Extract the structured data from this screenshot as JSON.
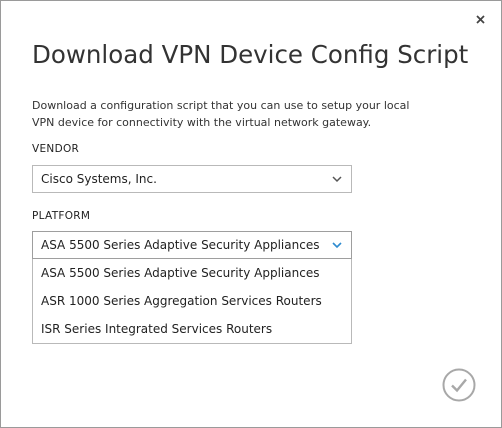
{
  "dialog": {
    "title": "Download VPN Device Config Script",
    "description": "Download a configuration script that you can use to setup your local VPN device for connectivity with the virtual network gateway."
  },
  "vendor": {
    "label": "VENDOR",
    "selected": "Cisco Systems, Inc."
  },
  "platform": {
    "label": "PLATFORM",
    "selected": "ASA 5500 Series Adaptive Security Appliances",
    "options": [
      "ASA 5500 Series Adaptive Security Appliances",
      "ASR 1000 Series Aggregation Services Routers",
      "ISR Series Integrated Services Routers"
    ]
  },
  "icons": {
    "close": "close-icon",
    "chevron": "chevron-down-icon",
    "confirm": "checkmark-circle-icon"
  },
  "colors": {
    "accent": "#2e8bd0",
    "ok_icon": "#a8a8a8"
  }
}
